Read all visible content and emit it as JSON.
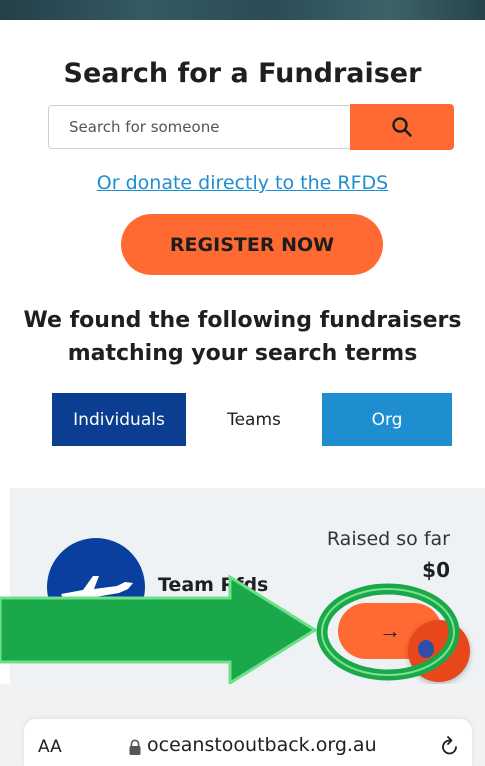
{
  "search": {
    "title": "Search for a Fundraiser",
    "placeholder": "Search for someone"
  },
  "donate_link": "Or donate directly to the RFDS",
  "register_label": "REGISTER NOW",
  "results": {
    "heading_line1": "We found the following fundraisers",
    "heading_line2": "matching your search terms"
  },
  "tabs": [
    {
      "label": "Individuals"
    },
    {
      "label": "Teams"
    },
    {
      "label": "Org"
    }
  ],
  "card": {
    "team_name": "Team Rfds",
    "raised_label": "Raised so far",
    "raised_amount": "$0",
    "view_glyph": "→"
  },
  "browser": {
    "text_size": "AA",
    "url": "oceanstooutback.org.au",
    "lock_icon": "lock-icon",
    "reload_icon": "reload-icon"
  },
  "colors": {
    "accent_orange": "#ff6a33",
    "link_blue": "#1d8fcf",
    "navy": "#0b3d91",
    "tab_blue": "#1e8ed1",
    "annotation_green": "#1aa84a"
  }
}
